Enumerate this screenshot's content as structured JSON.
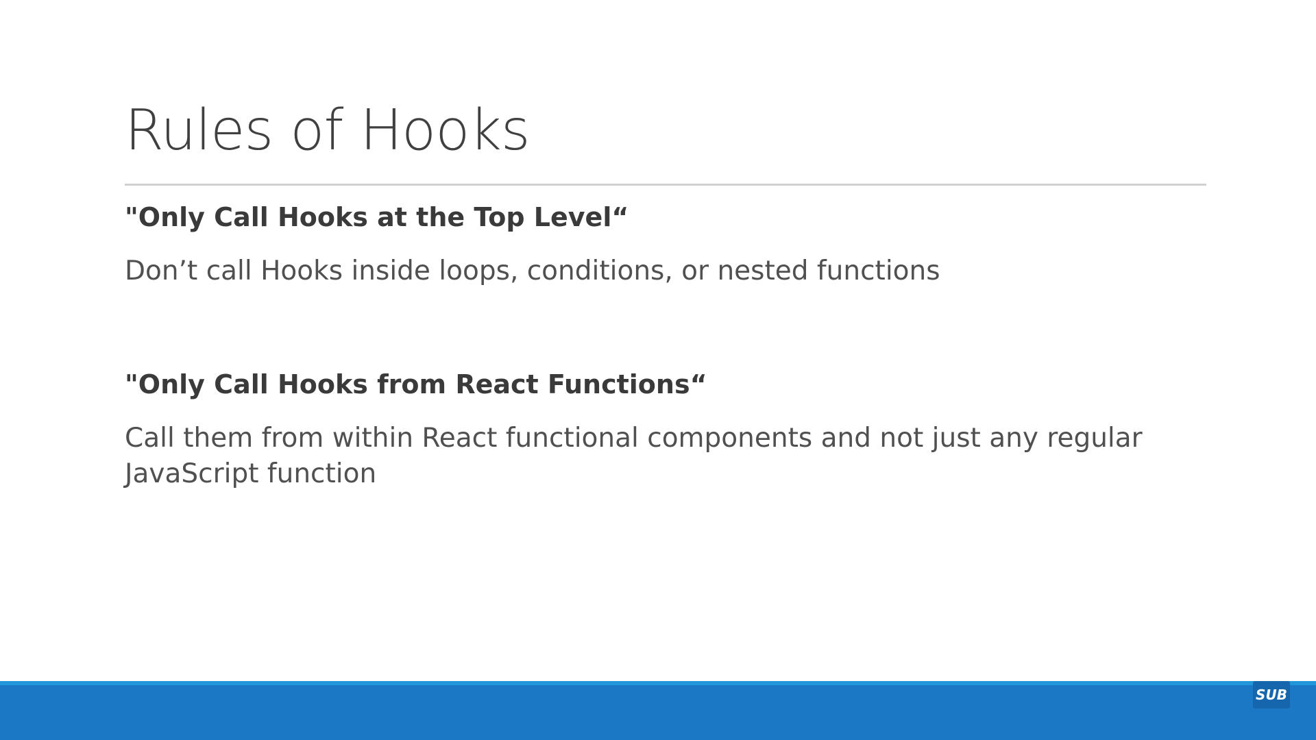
{
  "slide": {
    "title": "Rules of Hooks",
    "sections": [
      {
        "heading": "\"Only Call Hooks at the Top Level“",
        "body": "Don’t call Hooks inside loops, conditions, or nested functions"
      },
      {
        "heading": "\"Only Call Hooks from React Functions“",
        "body": "Call them from within React functional components and not just any regular JavaScript function"
      }
    ]
  },
  "footer": {
    "badge_text": "SUB"
  },
  "colors": {
    "title": "#404040",
    "rule": "#d0d0d0",
    "footer_bar": "#1b78c4",
    "footer_accent": "#2196d8",
    "badge": "#1566ad"
  }
}
